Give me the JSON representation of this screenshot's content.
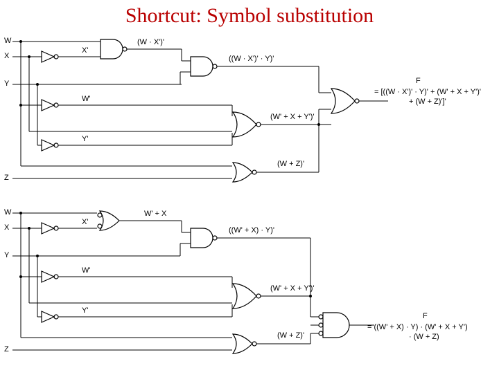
{
  "title": "Shortcut: Symbol substitution",
  "top": {
    "inputs": {
      "W": "W",
      "X": "X",
      "Y": "Y",
      "Z": "Z"
    },
    "xprime": "X'",
    "wprime": "W'",
    "yprime": "Y'",
    "n1": "(W · X')'",
    "n2": "((W · X')' · Y)'",
    "n3": "(W' + X + Y')'",
    "n4": "(W + Z)'",
    "F_label": "F",
    "F_eq1": "= [((W · X')' · Y)' + (W' + X + Y')'",
    "F_eq2": "+ (W + Z)']'"
  },
  "bottom": {
    "inputs": {
      "W": "W",
      "X": "X",
      "Y": "Y",
      "Z": "Z"
    },
    "xprime": "X'",
    "wprime": "W'",
    "yprime": "Y'",
    "o1": "W' + X",
    "n2": "((W' + X) · Y)'",
    "n3": "(W' + X + Y')'",
    "n4": "(W + Z)'",
    "F_label": "F",
    "F_eq1": "= ((W' + X) · Y) · (W' + X + Y')",
    "F_eq2": "· (W + Z)"
  }
}
